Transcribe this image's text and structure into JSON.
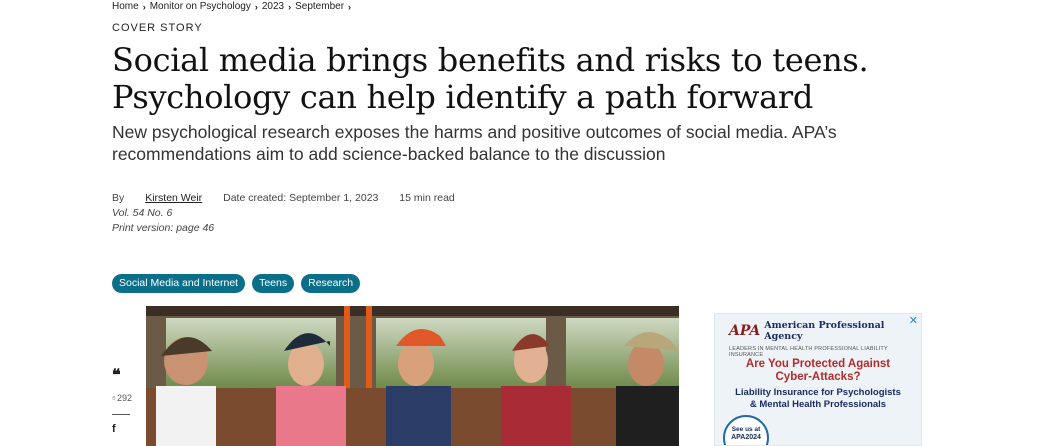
{
  "breadcrumb": [
    "Home",
    "Monitor on Psychology",
    "2023",
    "September"
  ],
  "kicker": "COVER STORY",
  "title_line1": "Social media brings benefits and risks to teens.",
  "title_line2": "Psychology can help identify a path forward",
  "subtitle": "New psychological research exposes the harms and positive outcomes of social media. APA’s recommendations aim to add science-backed balance to the discussion",
  "meta": {
    "by": "By",
    "author": "Kirsten Weir",
    "date": "Date created: September 1, 2023",
    "read_time": "15 min read",
    "volume": "Vol. 54 No. 6",
    "print_version": "Print version: page 46"
  },
  "tags": [
    "Social Media and Internet",
    "Teens",
    "Research"
  ],
  "share": {
    "quote_glyph": "❝",
    "clap_count": "292",
    "facebook_glyph": "f"
  },
  "ad": {
    "logo": "APA",
    "agency": "American Professional Agency",
    "leaders": "LEADERS IN MENTAL HEALTH PROFESSIONAL LIABILITY INSURANCE",
    "headline_1": "Are You Protected Against",
    "headline_2": "Cyber-Attacks?",
    "sub_1": "Liability Insurance for Psychologists",
    "sub_2": "& Mental Health Professionals",
    "badge_1": "See us at",
    "badge_2": "APA2024",
    "close_glyph": "✕"
  },
  "colors": {
    "tag_bg": "#0c6f8a",
    "ad_headline": "#b52a2a",
    "ad_navy": "#1a2c64"
  }
}
